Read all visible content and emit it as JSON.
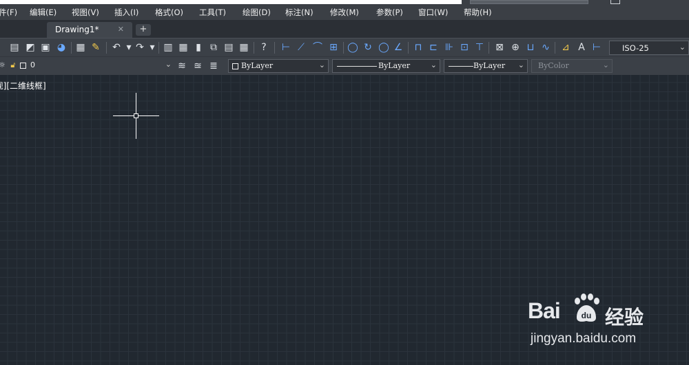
{
  "menu": {
    "items": [
      "件(F)",
      "编辑(E)",
      "视图(V)",
      "插入(I)",
      "格式(O)",
      "工具(T)",
      "绘图(D)",
      "标注(N)",
      "修改(M)",
      "参数(P)",
      "窗口(W)",
      "帮助(H)"
    ]
  },
  "tabs": {
    "active_label": "Drawing1*",
    "close_glyph": "✕",
    "add_glyph": "+"
  },
  "toolbar": {
    "dim_style": "ISO-25"
  },
  "properties": {
    "layer_value": "0",
    "color_value": "ByLayer",
    "linetype_value": "ByLayer",
    "lineweight_value": "ByLayer",
    "plotstyle_value": "ByColor"
  },
  "viewport": {
    "label": "[俯视][二维线框]"
  },
  "watermark": {
    "logo": "Bai",
    "logo_suffix": "du",
    "brand_cn": "经验",
    "url": "jingyan.baidu.com"
  },
  "colors": {
    "canvas_bg": "#212830",
    "toolbar_bg": "#3b4047",
    "menubar_bg": "#3b3f45",
    "accent_blue": "#6aa9ff"
  }
}
